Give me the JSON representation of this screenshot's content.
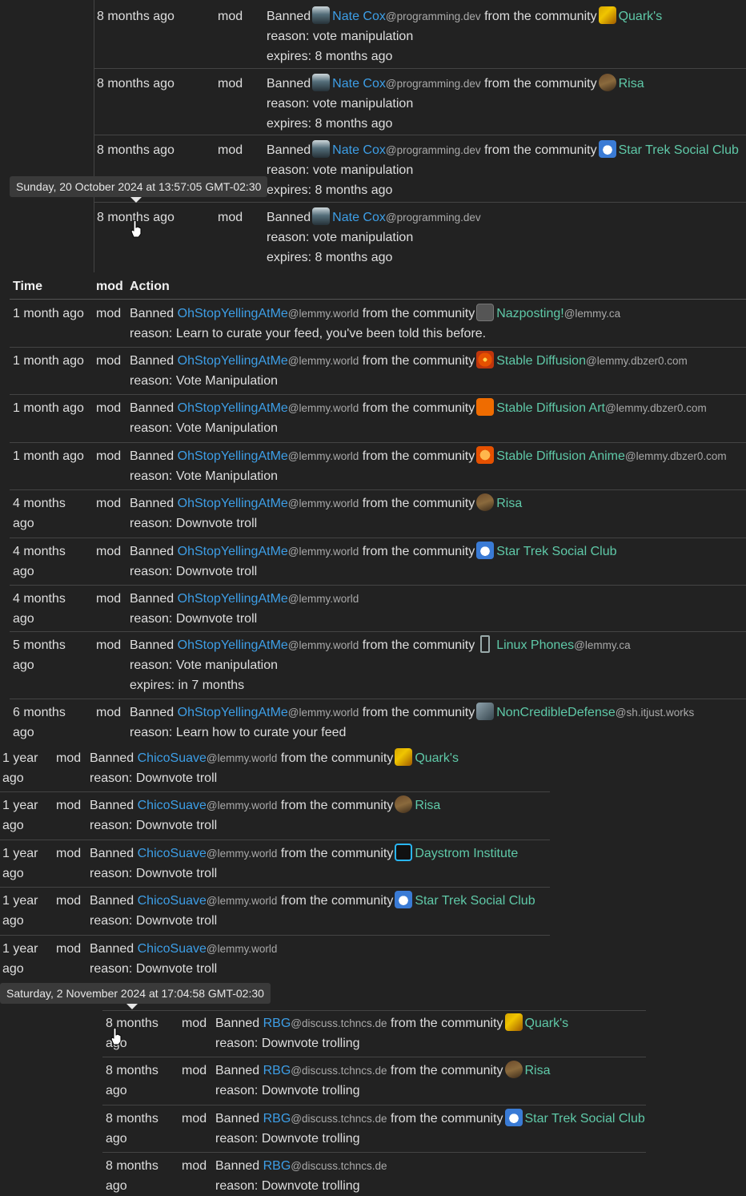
{
  "tooltips": {
    "first": "Sunday, 20 October 2024 at 13:57:05 GMT-02:30",
    "second": "Saturday, 2 November 2024 at 17:04:58 GMT-02:30"
  },
  "headers": {
    "time": "Time",
    "mod": "mod",
    "action": "Action"
  },
  "labels": {
    "banned": "Banned",
    "from": "from the community",
    "reason": "reason:",
    "expires": "expires:"
  },
  "section1": {
    "mod": "mod",
    "rows": [
      {
        "time": "8 months ago",
        "user": "Nate Cox",
        "inst": "@programming.dev",
        "community": "Quark's",
        "icon": "quark",
        "reason": "reason: vote manipulation",
        "expires": "expires: 8 months ago"
      },
      {
        "time": "8 months ago",
        "user": "Nate Cox",
        "inst": "@programming.dev",
        "community": "Risa",
        "icon": "risa",
        "reason": "reason: vote manipulation",
        "expires": "expires: 8 months ago"
      },
      {
        "time": "8 months ago",
        "user": "Nate Cox",
        "inst": "@programming.dev",
        "community": "Star Trek Social Club",
        "icon": "stsc",
        "reason": "reason: vote manipulation",
        "expires": "expires: 8 months ago"
      },
      {
        "time": "8 months ago",
        "user": "Nate Cox",
        "inst": "@programming.dev",
        "community": "",
        "icon": "",
        "reason": "reason: vote manipulation",
        "expires": "expires: 8 months ago"
      }
    ]
  },
  "section2": {
    "mod": "mod",
    "rows": [
      {
        "time": "1 month ago",
        "user": "OhStopYellingAtMe",
        "inst": "@lemmy.world",
        "community": "Nazposting!",
        "cinst": "@lemmy.ca",
        "icon": "generic",
        "reason": "reason: Learn to curate your feed, you've been told this before."
      },
      {
        "time": "1 month ago",
        "user": "OhStopYellingAtMe",
        "inst": "@lemmy.world",
        "community": "Stable Diffusion",
        "cinst": "@lemmy.dbzer0.com",
        "icon": "sd",
        "reason": "reason: Vote Manipulation"
      },
      {
        "time": "1 month ago",
        "user": "OhStopYellingAtMe",
        "inst": "@lemmy.world",
        "community": "Stable Diffusion Art",
        "cinst": "@lemmy.dbzer0.com",
        "icon": "sdart",
        "reason": "reason: Vote Manipulation"
      },
      {
        "time": "1 month ago",
        "user": "OhStopYellingAtMe",
        "inst": "@lemmy.world",
        "community": "Stable Diffusion Anime",
        "cinst": "@lemmy.dbzer0.com",
        "icon": "anime",
        "reason": "reason: Vote Manipulation"
      },
      {
        "time": "4 months ago",
        "user": "OhStopYellingAtMe",
        "inst": "@lemmy.world",
        "community": "Risa",
        "cinst": "",
        "icon": "risa",
        "reason": "reason: Downvote troll"
      },
      {
        "time": "4 months ago",
        "user": "OhStopYellingAtMe",
        "inst": "@lemmy.world",
        "community": "Star Trek Social Club",
        "cinst": "",
        "icon": "stsc",
        "reason": "reason: Downvote troll"
      },
      {
        "time": "4 months ago",
        "user": "OhStopYellingAtMe",
        "inst": "@lemmy.world",
        "community": "",
        "cinst": "",
        "icon": "",
        "reason": "reason: Downvote troll"
      },
      {
        "time": "5 months ago",
        "user": "OhStopYellingAtMe",
        "inst": "@lemmy.world",
        "community": "Linux Phones",
        "cinst": "@lemmy.ca",
        "icon": "phone",
        "reason": "reason: Vote manipulation",
        "expires": "expires: in 7 months"
      },
      {
        "time": "6 months ago",
        "user": "OhStopYellingAtMe",
        "inst": "@lemmy.world",
        "community": "NonCredibleDefense",
        "cinst": "@sh.itjust.works",
        "icon": "ncd",
        "reason": "reason: Learn how to curate your feed"
      }
    ]
  },
  "section3": {
    "mod": "mod",
    "rows": [
      {
        "time": "1 year ago",
        "user": "ChicoSuave",
        "inst": "@lemmy.world",
        "community": "Quark's",
        "icon": "quark",
        "reason": "reason: Downvote troll"
      },
      {
        "time": "1 year ago",
        "user": "ChicoSuave",
        "inst": "@lemmy.world",
        "community": "Risa",
        "icon": "risa",
        "reason": "reason: Downvote troll"
      },
      {
        "time": "1 year ago",
        "user": "ChicoSuave",
        "inst": "@lemmy.world",
        "community": "Daystrom Institute",
        "icon": "daystrom",
        "reason": "reason: Downvote troll"
      },
      {
        "time": "1 year ago",
        "user": "ChicoSuave",
        "inst": "@lemmy.world",
        "community": "Star Trek Social Club",
        "icon": "stsc",
        "reason": "reason: Downvote troll"
      },
      {
        "time": "1 year ago",
        "user": "ChicoSuave",
        "inst": "@lemmy.world",
        "community": "",
        "icon": "",
        "reason": "reason: Downvote troll"
      }
    ]
  },
  "section4": {
    "mod": "mod",
    "rows": [
      {
        "time": "8 months ago",
        "user": "RBG",
        "inst": "@discuss.tchncs.de",
        "community": "Quark's",
        "icon": "quark",
        "reason": "reason: Downvote trolling"
      },
      {
        "time": "8 months ago",
        "user": "RBG",
        "inst": "@discuss.tchncs.de",
        "community": "Risa",
        "icon": "risa",
        "reason": "reason: Downvote trolling"
      },
      {
        "time": "8 months ago",
        "user": "RBG",
        "inst": "@discuss.tchncs.de",
        "community": "Star Trek Social Club",
        "icon": "stsc",
        "reason": "reason: Downvote trolling"
      },
      {
        "time": "8 months ago",
        "user": "RBG",
        "inst": "@discuss.tchncs.de",
        "community": "",
        "icon": "",
        "reason": "reason: Downvote trolling"
      }
    ]
  }
}
